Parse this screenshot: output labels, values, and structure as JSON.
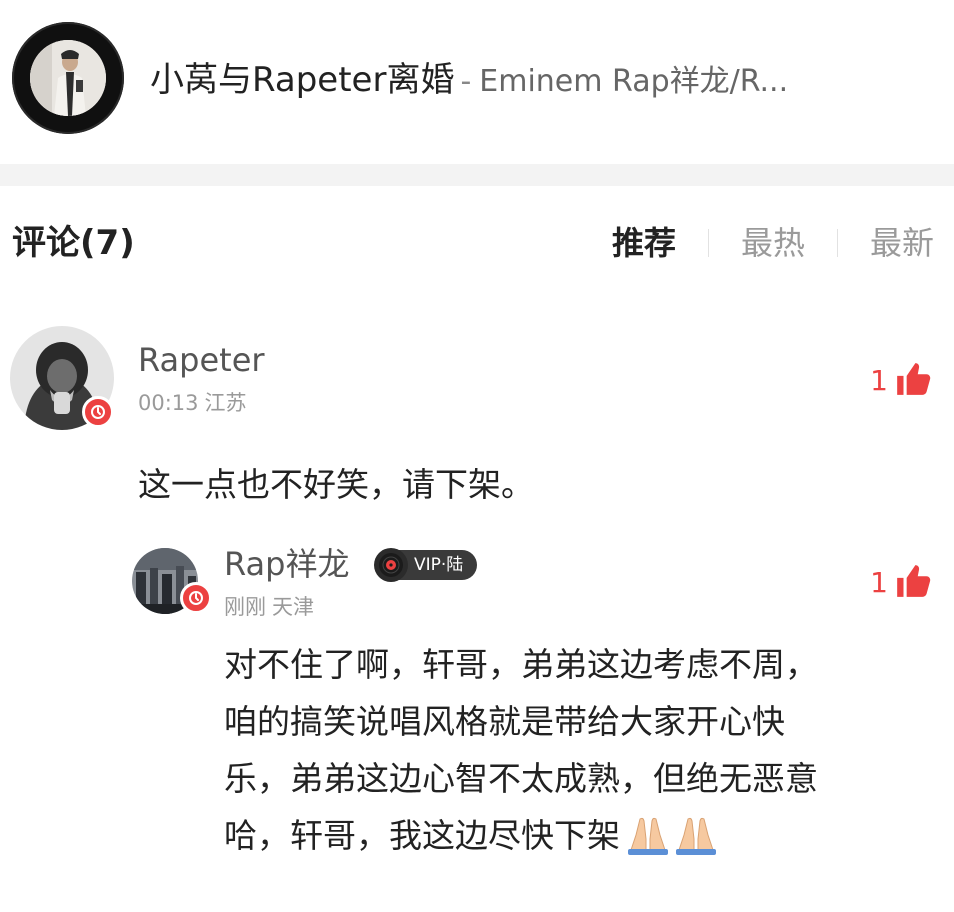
{
  "song": {
    "title": "小莴与Rapeter离婚",
    "separator": "-",
    "artist": "Eminem Rap祥龙/R..."
  },
  "comments_section": {
    "title": "评论(7)",
    "sort_tabs": [
      {
        "label": "推荐",
        "active": true
      },
      {
        "label": "最热",
        "active": false
      },
      {
        "label": "最新",
        "active": false
      }
    ]
  },
  "comments": [
    {
      "username": "Rapeter",
      "time": "00:13",
      "location": "江苏",
      "likes": "1",
      "text": "这一点也不好笑，请下架。",
      "avatar_icon": "user-avatar",
      "badge_icon": "music-badge-icon"
    }
  ],
  "replies": [
    {
      "username": "Rap祥龙",
      "vip_label": "VIP·陆",
      "time": "刚刚",
      "location": "天津",
      "likes": "1",
      "lines": [
        "对不住了啊，轩哥，弟弟这边考虑不周，",
        "咱的搞笑说唱风格就是带给大家开心快",
        "乐，弟弟这边心智不太成熟，但绝无恶意",
        "哈，轩哥，我这边尽快下架"
      ],
      "trailing_emoji": "praying-hands-emoji"
    }
  ],
  "colors": {
    "accent": "#ec4141",
    "muted": "#9a9a9a",
    "band": "#f3f3f3"
  }
}
